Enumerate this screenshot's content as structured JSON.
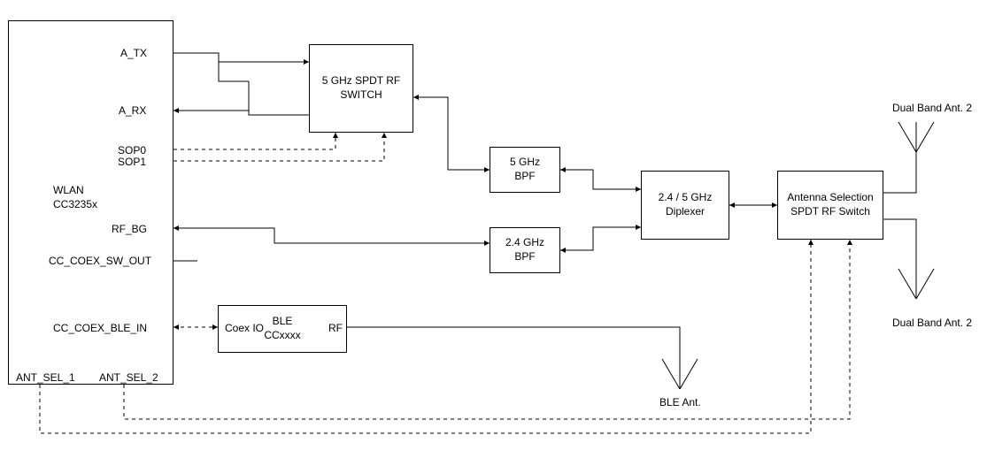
{
  "wlan": {
    "title": "WLAN\nCC3235x"
  },
  "pins": {
    "a_tx": "A_TX",
    "a_rx": "A_RX",
    "sop0": "SOP0",
    "sop1": "SOP1",
    "rf_bg": "RF_BG",
    "coex_sw_out": "CC_COEX_SW_OUT",
    "coex_ble_in": "CC_COEX_BLE_IN",
    "ant_sel_1": "ANT_SEL_1",
    "ant_sel_2": "ANT_SEL_2"
  },
  "blocks": {
    "switch_5g": "5 GHz SPDT RF\nSWITCH",
    "bpf_5g": "5 GHz\nBPF",
    "bpf_24g": "2.4 GHz\nBPF",
    "diplexer": "2.4 / 5 GHz\nDiplexer",
    "ant_switch": "Antenna Selection\nSPDT RF Switch",
    "ble": "BLE\nCCxxxx",
    "ble_coex": "Coex IO",
    "ble_rf": "RF"
  },
  "antennas": {
    "top": "Dual Band Ant. 2",
    "bottom": "Dual Band Ant. 2",
    "ble": "BLE Ant."
  }
}
